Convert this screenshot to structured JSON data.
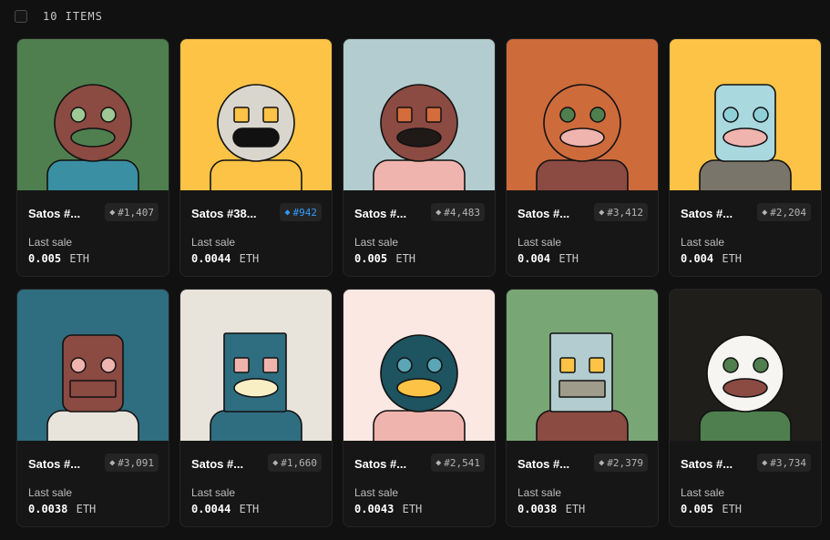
{
  "header": {
    "items_count": "10 ITEMS"
  },
  "common": {
    "last_sale_label": "Last sale",
    "currency": "ETH",
    "rank_icon": "diamond-icon"
  },
  "cards": [
    {
      "name": "Satos #...",
      "rank": "#1,407",
      "price": "0.005",
      "highlight": false,
      "art": {
        "bg": "#4f7f4e",
        "head": "#8b4a42",
        "headShape": "circle",
        "eyes": "#9ec995",
        "eyeShape": "circle",
        "mouth": "#4f7f4e",
        "mouthShape": "ellipse",
        "body": "#3a8fa3"
      }
    },
    {
      "name": "Satos #38...",
      "rank": "#942",
      "price": "0.0044",
      "highlight": true,
      "art": {
        "bg": "#fcc346",
        "head": "#d9d6ce",
        "headShape": "circle",
        "eyes": "#fcc346",
        "eyeShape": "square",
        "mouth": "#111111",
        "mouthShape": "pill",
        "body": "#fcc346"
      }
    },
    {
      "name": "Satos #...",
      "rank": "#4,483",
      "price": "0.005",
      "highlight": false,
      "art": {
        "bg": "#b3cccf",
        "head": "#8b4a42",
        "headShape": "circle",
        "eyes": "#d46c3b",
        "eyeShape": "square",
        "mouth": "#1f1a18",
        "mouthShape": "ellipse",
        "body": "#f0b4ae"
      }
    },
    {
      "name": "Satos #...",
      "rank": "#3,412",
      "price": "0.004",
      "highlight": false,
      "art": {
        "bg": "#ce6b3b",
        "head": "#ce6b3b",
        "headShape": "circle",
        "eyes": "#4f7f4e",
        "eyeShape": "circle",
        "mouth": "#f0b4ae",
        "mouthShape": "ellipse",
        "body": "#8b4a42"
      }
    },
    {
      "name": "Satos #...",
      "rank": "#2,204",
      "price": "0.004",
      "highlight": false,
      "art": {
        "bg": "#fcc346",
        "head": "#a9d8de",
        "headShape": "roundrect",
        "eyes": "#8fcfd8",
        "eyeShape": "circle",
        "mouth": "#f0b4ae",
        "mouthShape": "ellipse",
        "body": "#7a756a"
      }
    },
    {
      "name": "Satos #...",
      "rank": "#3,091",
      "price": "0.0038",
      "highlight": false,
      "art": {
        "bg": "#2e6e80",
        "head": "#8b4a42",
        "headShape": "roundrect",
        "eyes": "#f0b4ae",
        "eyeShape": "circle",
        "mouth": "#8b4a42",
        "mouthShape": "rect",
        "body": "#e8e3db"
      }
    },
    {
      "name": "Satos #...",
      "rank": "#1,660",
      "price": "0.0044",
      "highlight": false,
      "art": {
        "bg": "#e8e3db",
        "head": "#2e6e80",
        "headShape": "rect",
        "eyes": "#f0b4ae",
        "eyeShape": "square",
        "mouth": "#f9efc4",
        "mouthShape": "ellipse",
        "body": "#2e6e80"
      }
    },
    {
      "name": "Satos #...",
      "rank": "#2,541",
      "price": "0.0043",
      "highlight": false,
      "art": {
        "bg": "#fbe8e3",
        "head": "#1e5360",
        "headShape": "circle",
        "eyes": "#5aa6b7",
        "eyeShape": "circle",
        "mouth": "#fcc346",
        "mouthShape": "ellipse",
        "body": "#f0b4ae"
      }
    },
    {
      "name": "Satos #...",
      "rank": "#2,379",
      "price": "0.0038",
      "highlight": false,
      "art": {
        "bg": "#79a675",
        "head": "#b3cccf",
        "headShape": "rect",
        "eyes": "#fcc346",
        "eyeShape": "square",
        "mouth": "#a09c8c",
        "mouthShape": "rect",
        "body": "#8b4a42"
      }
    },
    {
      "name": "Satos #...",
      "rank": "#3,734",
      "price": "0.005",
      "highlight": false,
      "art": {
        "bg": "#201e1b",
        "head": "#f7f5f2",
        "headShape": "circle",
        "eyes": "#4f7f4e",
        "eyeShape": "circle",
        "mouth": "#8b4a42",
        "mouthShape": "ellipse",
        "body": "#4f7f4e"
      }
    }
  ]
}
